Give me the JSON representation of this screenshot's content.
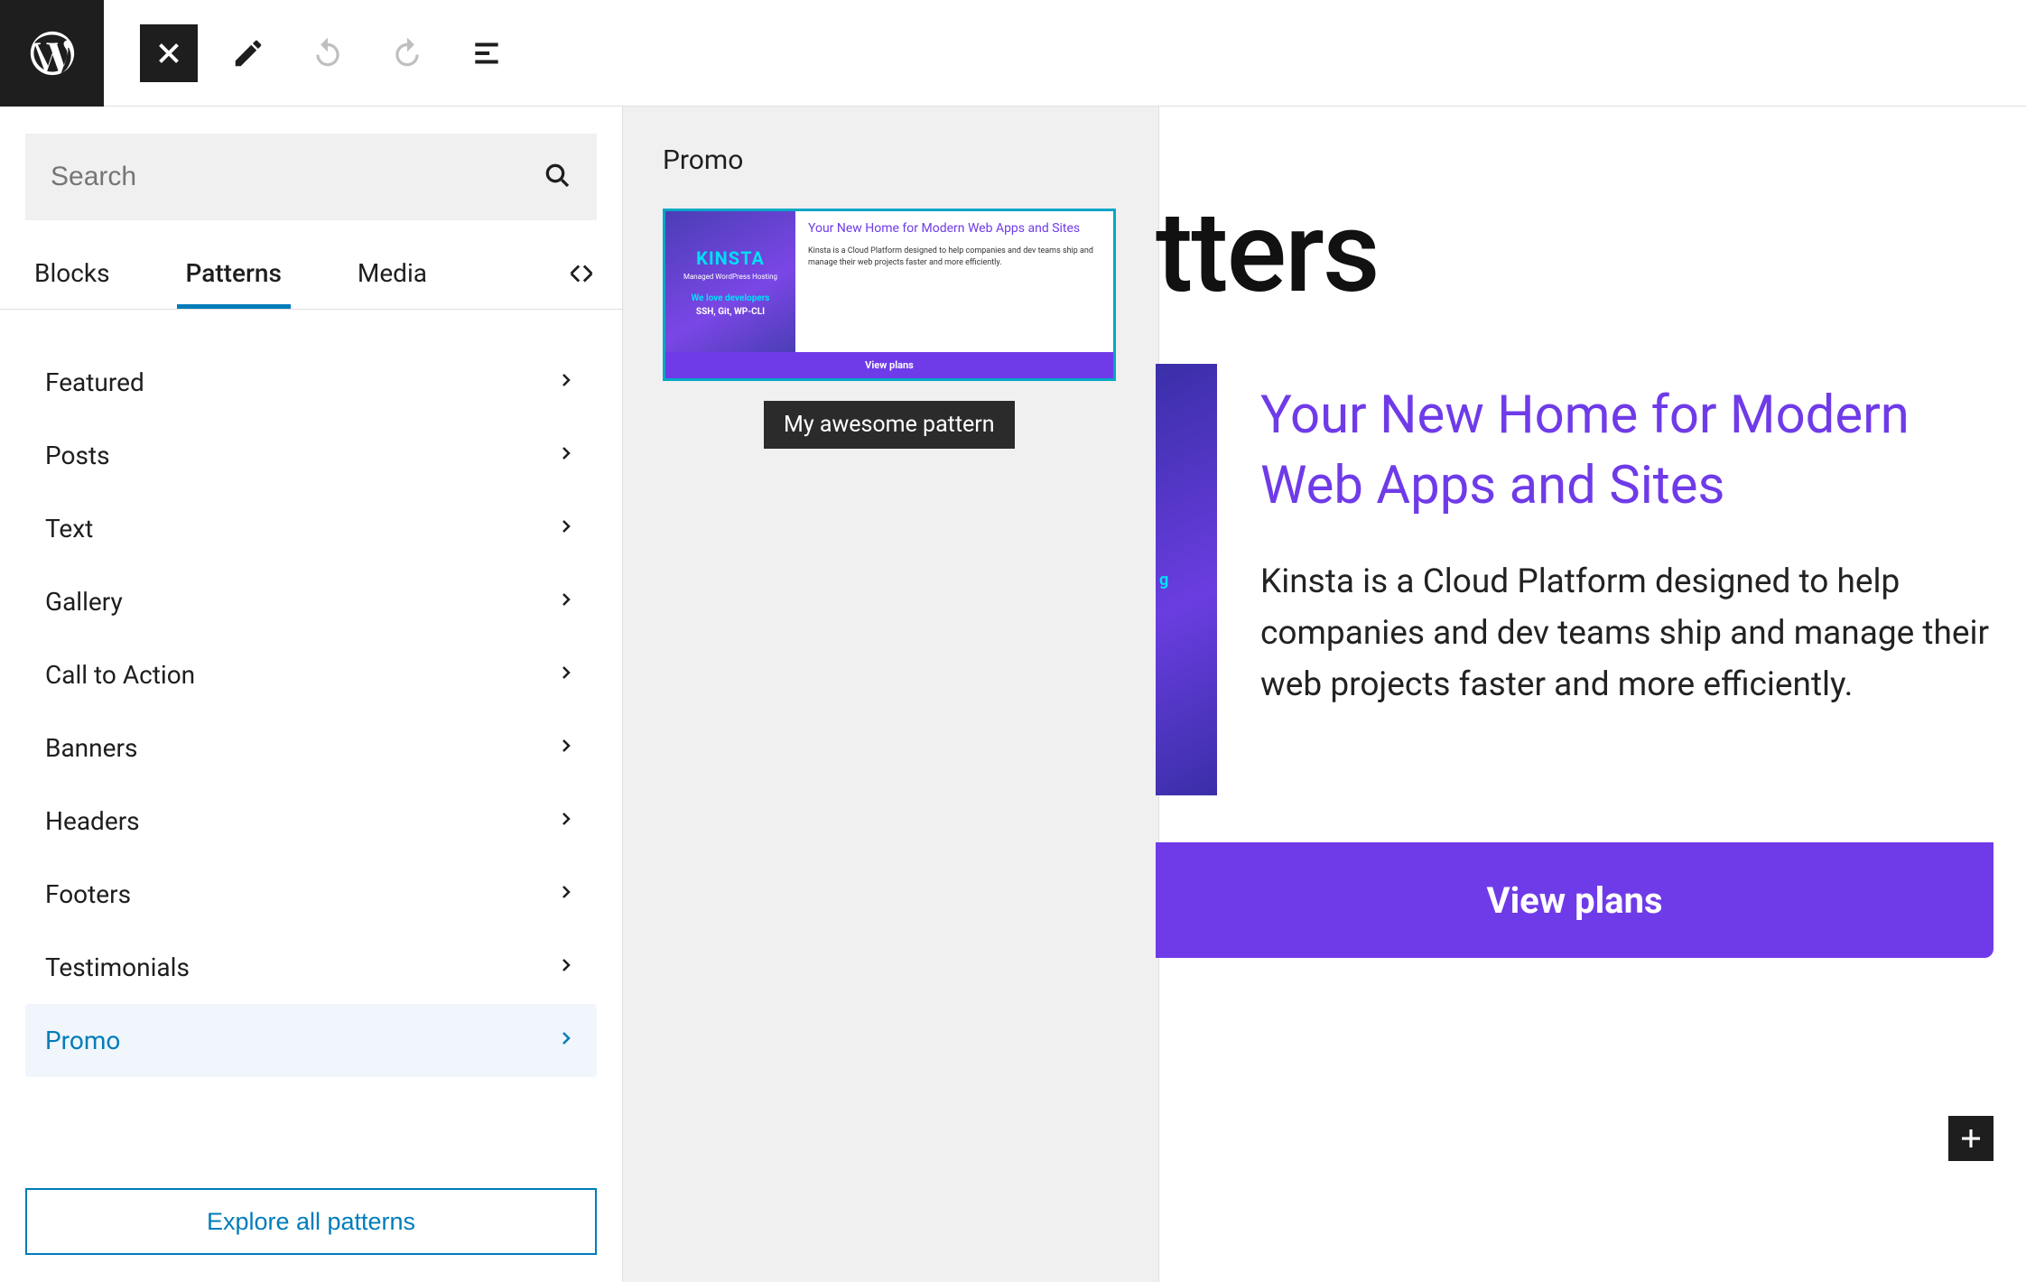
{
  "search": {
    "placeholder": "Search"
  },
  "tabs": {
    "blocks": "Blocks",
    "patterns": "Patterns",
    "media": "Media"
  },
  "categories": [
    {
      "label": "Featured"
    },
    {
      "label": "Posts"
    },
    {
      "label": "Text"
    },
    {
      "label": "Gallery"
    },
    {
      "label": "Call to Action"
    },
    {
      "label": "Banners"
    },
    {
      "label": "Headers"
    },
    {
      "label": "Footers"
    },
    {
      "label": "Testimonials"
    },
    {
      "label": "Promo"
    }
  ],
  "explore_button": "Explore all patterns",
  "pattern_panel": {
    "title": "Promo",
    "tooltip": "My awesome pattern",
    "thumb": {
      "logo": "KINSTA",
      "logo_sub": "Managed WordPress Hosting",
      "dev1": "We love developers",
      "dev2": "SSH, Git, WP-CLI",
      "heading": "Your New Home for Modern Web Apps and Sites",
      "body": "Kinsta is a Cloud Platform designed to help companies and dev teams ship and manage their web projects faster and more efficiently.",
      "cta": "View plans"
    }
  },
  "canvas": {
    "title_fragment": "tters",
    "img_text": "g",
    "heading": "Your New Home for Modern Web Apps and Sites",
    "paragraph": "Kinsta is a Cloud Platform designed to help companies and dev teams ship and manage their web projects faster and more efficiently.",
    "cta": "View plans"
  }
}
